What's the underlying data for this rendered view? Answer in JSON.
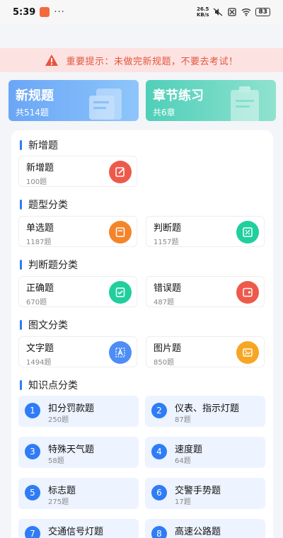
{
  "status_bar": {
    "time": "5:39",
    "dots": "···",
    "net_speed_value": "26.5",
    "net_speed_unit": "KB/s",
    "battery": "83"
  },
  "banner": {
    "text": "重要提示：未做完新规题，不要去考试！"
  },
  "cards": [
    {
      "title": "新规题",
      "sub": "共514题"
    },
    {
      "title": "章节练习",
      "sub": "共6章"
    }
  ],
  "sections": [
    {
      "title": "新增题"
    },
    {
      "title": "题型分类"
    },
    {
      "title": "判断题分类"
    },
    {
      "title": "图文分类"
    },
    {
      "title": "知识点分类"
    }
  ],
  "tiles": [
    {
      "label": "新增题",
      "count": "100题",
      "icon": "edit-icon",
      "color": "#ee5a4a"
    },
    {
      "label": "单选题",
      "count": "1187题",
      "icon": "single-choice-icon",
      "color": "#f4842a"
    },
    {
      "label": "判断题",
      "count": "1157题",
      "icon": "judge-icon",
      "color": "#1fcf9c"
    },
    {
      "label": "正确题",
      "count": "670题",
      "icon": "correct-icon",
      "color": "#1fcf9c"
    },
    {
      "label": "错误题",
      "count": "487题",
      "icon": "wrong-icon",
      "color": "#ee5a4a"
    },
    {
      "label": "文字题",
      "count": "1494题",
      "icon": "text-icon",
      "color": "#4d8df6"
    },
    {
      "label": "图片题",
      "count": "850题",
      "icon": "image-icon",
      "color": "#f7a623"
    }
  ],
  "knowledge": [
    {
      "num": "1",
      "label": "扣分罚款题",
      "count": "250题"
    },
    {
      "num": "2",
      "label": "仪表、指示灯题",
      "count": "87题"
    },
    {
      "num": "3",
      "label": "特殊天气题",
      "count": "58题"
    },
    {
      "num": "4",
      "label": "速度题",
      "count": "64题"
    },
    {
      "num": "5",
      "label": "标志题",
      "count": "275题"
    },
    {
      "num": "6",
      "label": "交警手势题",
      "count": "17题"
    },
    {
      "num": "7",
      "label": "交通信号灯题",
      "count": ""
    },
    {
      "num": "8",
      "label": "高速公路题",
      "count": ""
    }
  ]
}
